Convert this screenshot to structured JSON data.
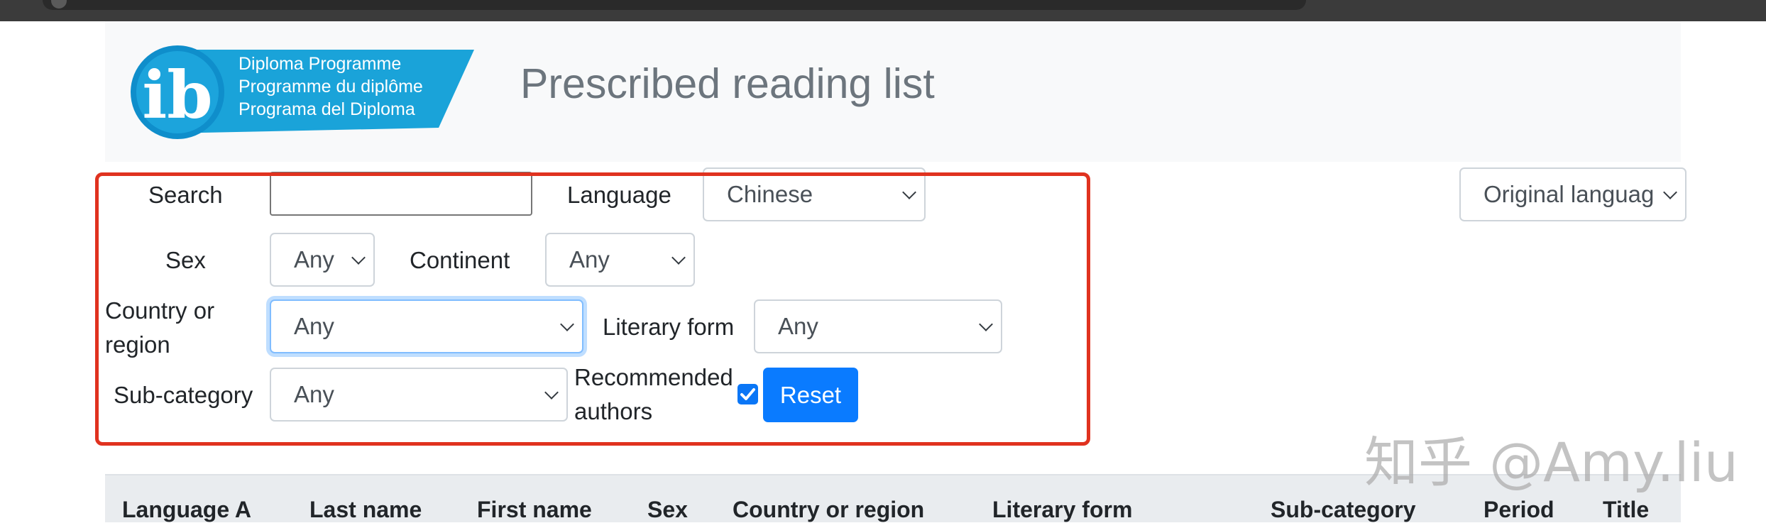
{
  "page": {
    "title": "Prescribed reading list"
  },
  "logo": {
    "brand": "ib",
    "lines": [
      "Diploma Programme",
      "Programme du diplôme",
      "Programa del Diploma"
    ]
  },
  "filters": {
    "search_label": "Search",
    "search_value": "",
    "language_label": "Language",
    "language_value": "Chinese",
    "sex_label": "Sex",
    "sex_value": "Any",
    "continent_label": "Continent",
    "continent_value": "Any",
    "country_label": "Country or region",
    "country_value": "Any",
    "literary_form_label": "Literary form",
    "literary_form_value": "Any",
    "subcategory_label": "Sub-category",
    "subcategory_value": "Any",
    "recommended_label": "Recommended authors",
    "recommended_checked": true,
    "reset_label": "Reset",
    "original_language_value": "Original languag"
  },
  "table": {
    "headers": [
      "Language A",
      "Last name",
      "First name",
      "Sex",
      "Country or region",
      "Literary form",
      "Sub-category",
      "Period",
      "Title"
    ]
  },
  "watermark": "知乎 @Amy.liu",
  "colors": {
    "accent": "#0a7bff",
    "highlight": "#e0321f",
    "title_gray": "#6c757d",
    "logo_blue": "#1aa3d9"
  }
}
